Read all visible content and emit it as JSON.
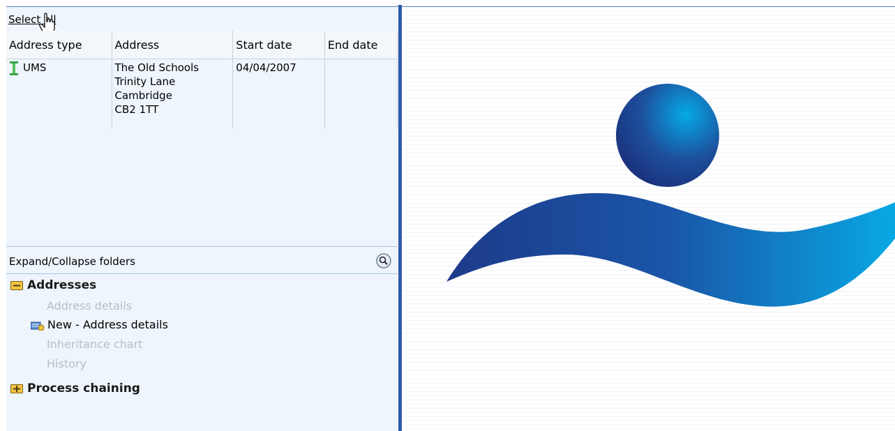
{
  "toolbar": {
    "select_all": "Select all"
  },
  "grid": {
    "columns": [
      "Address type",
      "Address",
      "Start date",
      "End date"
    ],
    "rows": [
      {
        "type": "UMS",
        "address_lines": [
          "The Old Schools",
          "Trinity Lane",
          "Cambridge",
          "CB2 1TT"
        ],
        "start": "04/04/2007",
        "end": ""
      }
    ]
  },
  "tree": {
    "header": "Expand/Collapse folders",
    "folders": [
      {
        "label": "Addresses",
        "expanded": true
      },
      {
        "label": "Process chaining",
        "expanded": false
      }
    ],
    "items": [
      {
        "label": "Address details",
        "enabled": false
      },
      {
        "label": "New - Address details",
        "enabled": true
      },
      {
        "label": "Inheritance chart",
        "enabled": false
      },
      {
        "label": "History",
        "enabled": false
      }
    ]
  },
  "colors": {
    "accent": "#2f5aa8",
    "panel": "#eef5fc",
    "logo_dark": "#1e3a8a",
    "logo_light": "#0ea5e9"
  }
}
